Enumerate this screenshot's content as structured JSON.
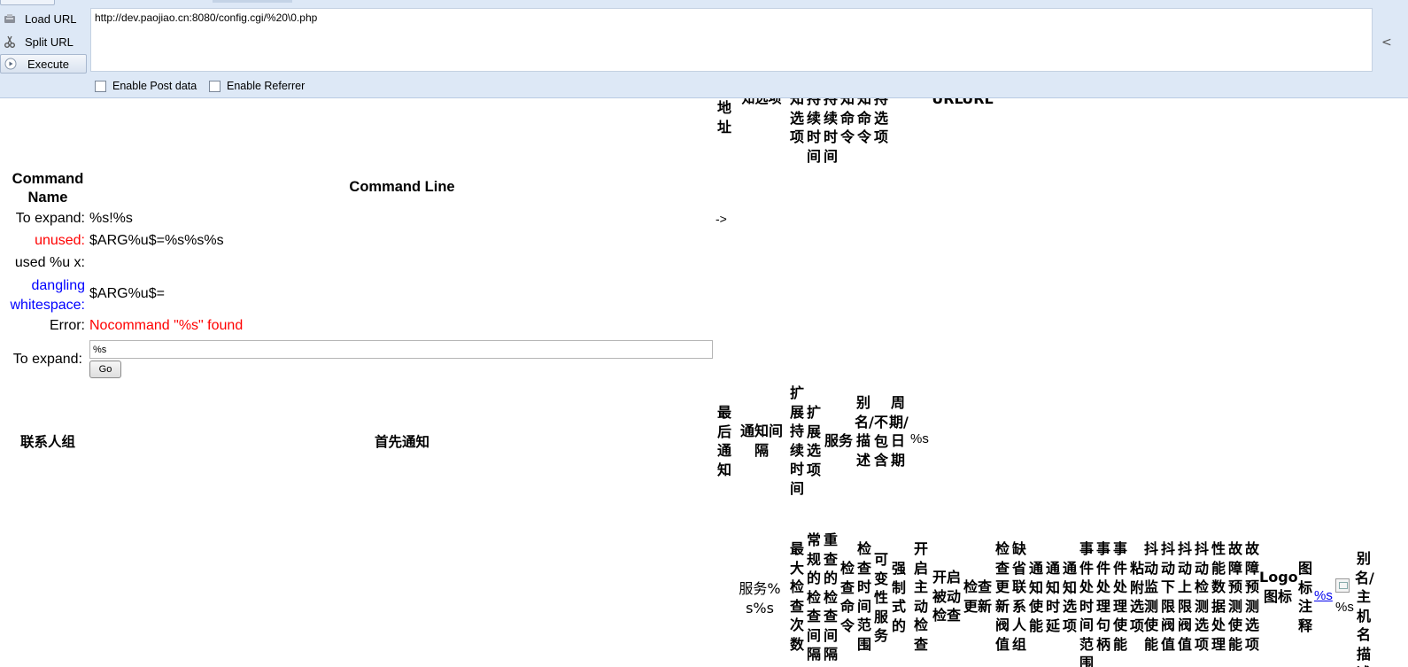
{
  "hackbar": {
    "load_url_label": "Load URL",
    "split_url_label": "Split URL",
    "execute_label": "Execute",
    "url_value": "http://dev.paojiao.cn:8080/config.cgi/%20\\0.php",
    "enable_post_label": "Enable Post data",
    "enable_referrer_label": "Enable Referrer",
    "side_arrow": "<"
  },
  "top_row": {
    "col1": "地址",
    "col2": "知选项",
    "col3": "知选项",
    "col4": "持续时间",
    "col5": "持续时间",
    "col6": "知命令",
    "col7": "知命令",
    "col8": "持选项",
    "url1": "URL",
    "url2": "URL"
  },
  "command": {
    "name_header": "Command Name",
    "line_header": "Command Line",
    "arrow": "->",
    "rows": [
      {
        "label": "To expand:",
        "value": "%s!%s"
      },
      {
        "label": "unused:",
        "value": "$ARG%u$=%s%s%s"
      },
      {
        "label": "used %u x:",
        "value": ""
      },
      {
        "label": "dangling whitespace:",
        "value": "$ARG%u$="
      },
      {
        "label": "Error:",
        "value": "Nocommand \"%s\" found"
      }
    ],
    "expand_label": "To expand:",
    "expand_input_value": "%s",
    "go_label": "Go"
  },
  "contact_row": {
    "contact_group": "联系人组",
    "first_notify": "首先通知",
    "last_notify": "最后通知",
    "notify_interval": "通知间隔",
    "ext_duration": "扩展持续时间",
    "ext_option": "扩展选项",
    "service": "服务",
    "alias_exclude": "别名/描述",
    "not_include": "不包含",
    "period_date": "周期/日期",
    "pct_s": "%s"
  },
  "bottom_row": {
    "service_s": "服务%s%s",
    "max_checks": "最大检查次数",
    "regular_interval": "常规的检查间隔",
    "retry_interval": "重查的检查间隔",
    "check_command": "检查命令",
    "check_period": "检查时间范围",
    "volatile": "可变性服务",
    "forced": "强制式的",
    "active_checks": "开启主动检查",
    "passive_checks": "开启被动检查",
    "check_fresh": "检查更新",
    "freshness_threshold": "检查更新阀值",
    "default_contact": "缺省联系人组",
    "notify_enabled": "通知使能",
    "notify_delay": "通知时延",
    "notify_option": "通知选项",
    "event_period": "事件处时间范围",
    "event_handler": "事件处理句柄",
    "event_enabled": "事件处理使能",
    "sticky_option": "粘附选项",
    "flap_detect": "抖动监测使能",
    "flap_low": "抖动下限阀值",
    "flap_high": "抖动上限阀值",
    "flap_option": "抖动检测选项",
    "perf_data": "性能数据处理",
    "fault_predict": "故障预测使能",
    "fault_option": "故障预测选项",
    "logo": "Logo图标",
    "icon_note": "图标注释",
    "link_pct": "%s",
    "pct_s": "%s",
    "host_alias": "别名/主机名描述"
  }
}
